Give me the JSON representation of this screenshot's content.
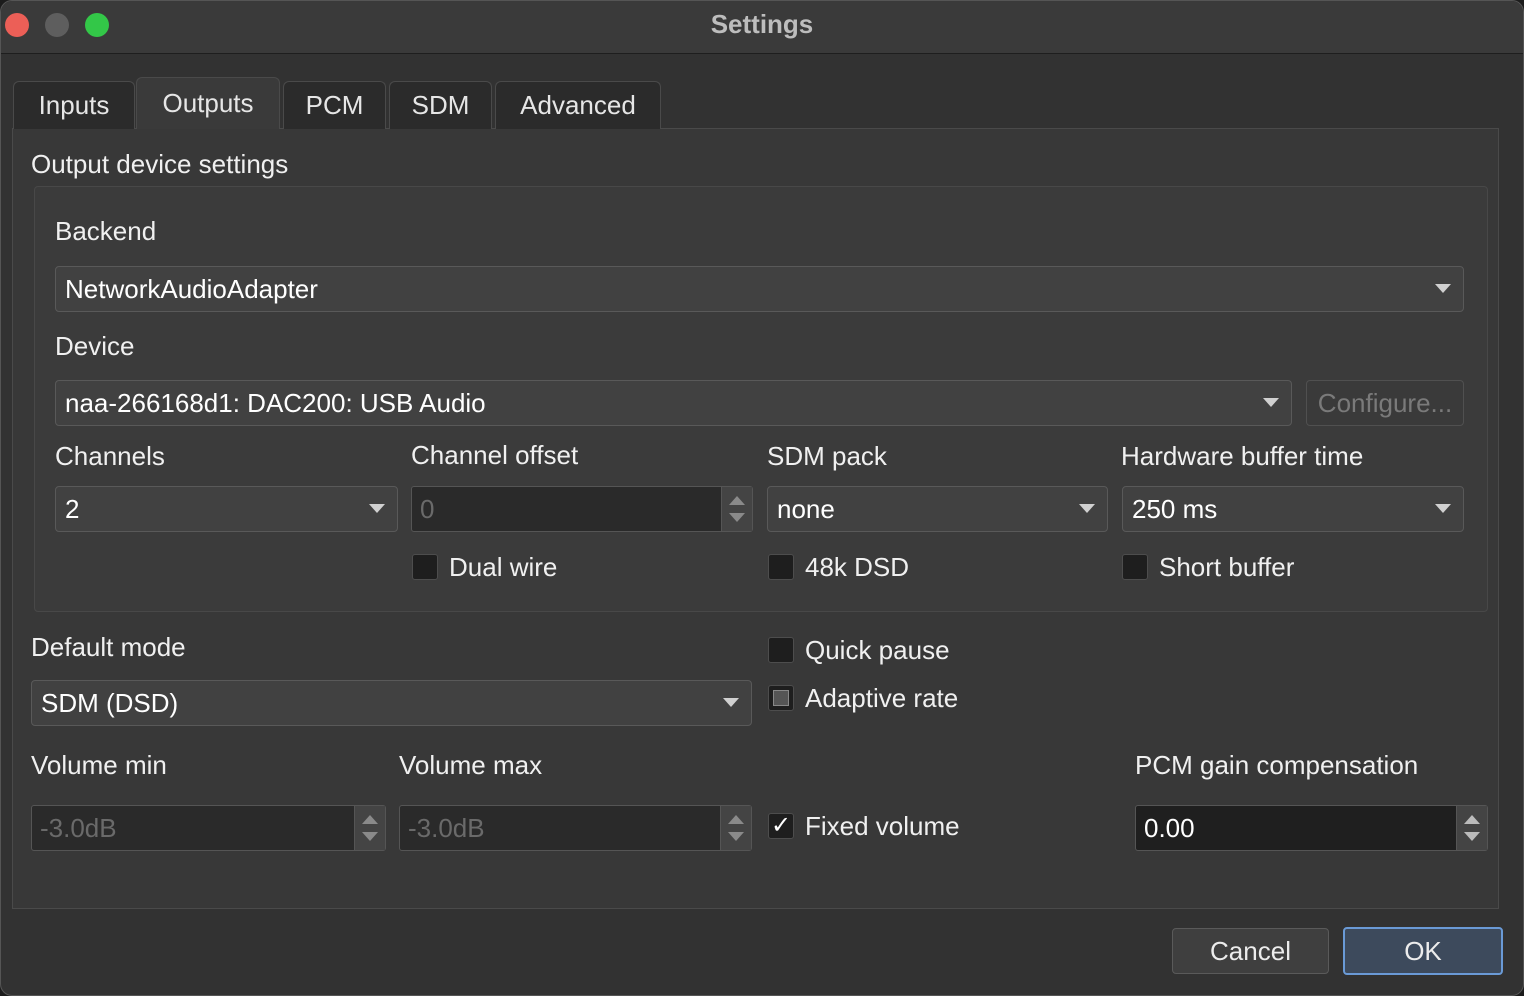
{
  "window": {
    "title": "Settings"
  },
  "tabs": [
    {
      "label": "Inputs"
    },
    {
      "label": "Outputs"
    },
    {
      "label": "PCM"
    },
    {
      "label": "SDM"
    },
    {
      "label": "Advanced"
    }
  ],
  "active_tab": "Outputs",
  "output_device": {
    "group_title": "Output device settings",
    "backend_label": "Backend",
    "backend_value": "NetworkAudioAdapter",
    "device_label": "Device",
    "device_value": "naa-266168d1: DAC200: USB Audio",
    "configure_label": "Configure...",
    "channels_label": "Channels",
    "channels_value": "2",
    "channel_offset_label": "Channel offset",
    "channel_offset_value": "0",
    "sdm_pack_label": "SDM pack",
    "sdm_pack_value": "none",
    "hw_buffer_label": "Hardware buffer time",
    "hw_buffer_value": "250 ms",
    "dual_wire_label": "Dual wire",
    "dsd48k_label": "48k DSD",
    "short_buffer_label": "Short buffer"
  },
  "default_mode": {
    "label": "Default mode",
    "value": "SDM (DSD)"
  },
  "options": {
    "quick_pause_label": "Quick pause",
    "adaptive_rate_label": "Adaptive rate",
    "fixed_volume_label": "Fixed volume",
    "fixed_volume_check": "✓"
  },
  "volume": {
    "min_label": "Volume min",
    "min_value": "-3.0dB",
    "max_label": "Volume max",
    "max_value": "-3.0dB"
  },
  "pcm_gain": {
    "label": "PCM gain compensation",
    "value": "0.00"
  },
  "footer": {
    "cancel_label": "Cancel",
    "ok_label": "OK"
  }
}
